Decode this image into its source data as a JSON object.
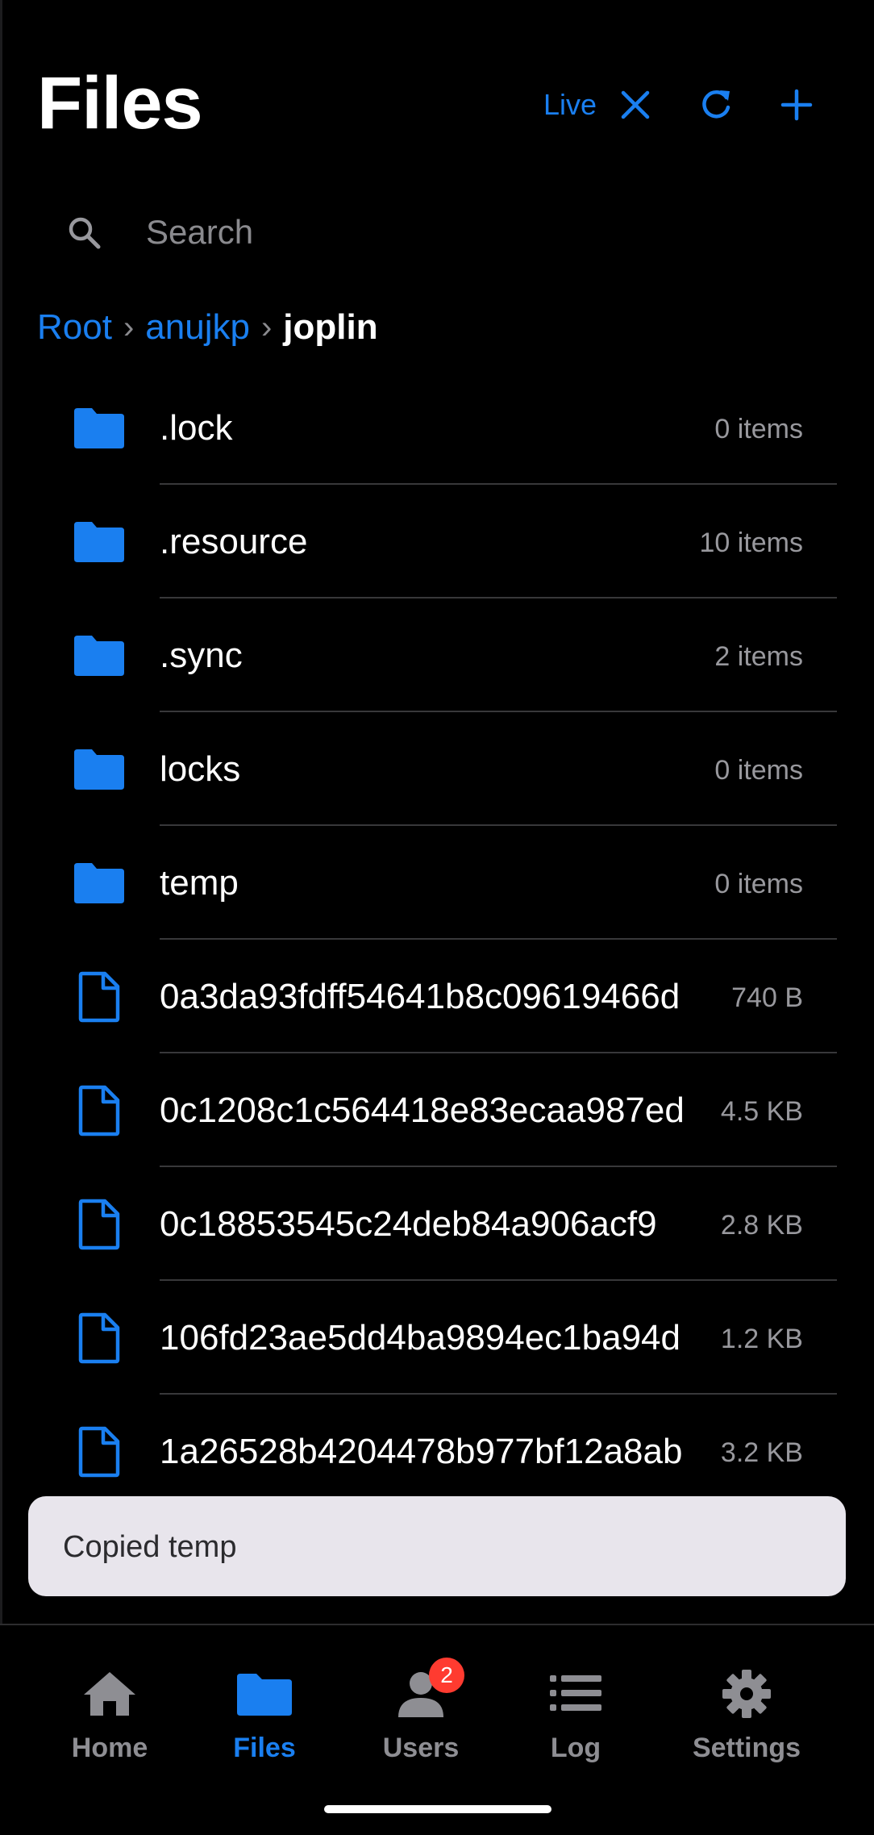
{
  "header": {
    "title": "Files",
    "live_label": "Live"
  },
  "search": {
    "placeholder": "Search"
  },
  "breadcrumb": {
    "root": "Root",
    "user": "anujkp",
    "current": "joplin",
    "separator": "›"
  },
  "items": [
    {
      "type": "folder",
      "name": ".lock",
      "meta": "0 items"
    },
    {
      "type": "folder",
      "name": ".resource",
      "meta": "10 items"
    },
    {
      "type": "folder",
      "name": ".sync",
      "meta": "2 items"
    },
    {
      "type": "folder",
      "name": "locks",
      "meta": "0 items"
    },
    {
      "type": "folder",
      "name": "temp",
      "meta": "0 items"
    },
    {
      "type": "file",
      "name": "0a3da93fdff54641b8c09619466d",
      "meta": "740 B"
    },
    {
      "type": "file",
      "name": "0c1208c1c564418e83ecaa987ed",
      "meta": "4.5 KB"
    },
    {
      "type": "file",
      "name": "0c18853545c24deb84a906acf9",
      "meta": "2.8 KB"
    },
    {
      "type": "file",
      "name": "106fd23ae5dd4ba9894ec1ba94d",
      "meta": "1.2 KB"
    },
    {
      "type": "file",
      "name": "1a26528b4204478b977bf12a8ab",
      "meta": "3.2 KB"
    }
  ],
  "toast": {
    "message": "Copied temp"
  },
  "tabs": [
    {
      "label": "Home",
      "icon": "home-icon",
      "active": false
    },
    {
      "label": "Files",
      "icon": "folder-icon",
      "active": true
    },
    {
      "label": "Users",
      "icon": "user-icon",
      "active": false,
      "badge": "2"
    },
    {
      "label": "Log",
      "icon": "list-icon",
      "active": false
    },
    {
      "label": "Settings",
      "icon": "gear-icon",
      "active": false
    }
  ],
  "colors": {
    "accent": "#1a7ff0",
    "background": "#000000",
    "secondary_text": "#98989d",
    "badge": "#ff3b30",
    "toast_bg": "#e8e5ec"
  }
}
